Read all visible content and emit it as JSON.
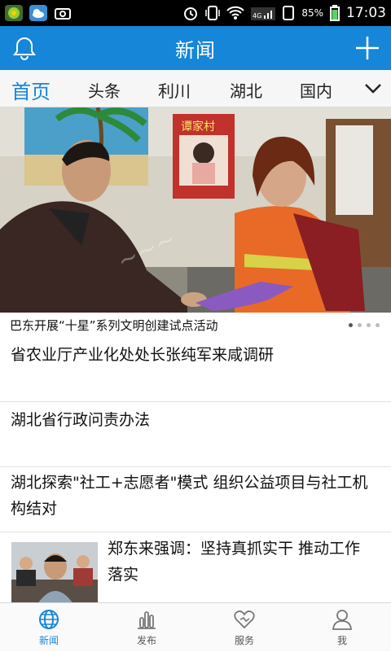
{
  "status_bar": {
    "time": "17:03",
    "battery": "85%",
    "network": "4G",
    "icons": [
      "app-icon-green",
      "weather-icon",
      "screenshot-icon",
      "alarm-icon",
      "vibrate-icon",
      "wifi-icon",
      "signal-icon",
      "battery-icon"
    ]
  },
  "header": {
    "title": "新闻",
    "left_icon": "bell-icon",
    "right_icon": "plus-icon"
  },
  "tabs": [
    {
      "label": "首页",
      "active": true
    },
    {
      "label": "头条",
      "active": false
    },
    {
      "label": "利川",
      "active": false
    },
    {
      "label": "湖北",
      "active": false
    },
    {
      "label": "国内",
      "active": false
    }
  ],
  "hero": {
    "caption": "巴东开展“十星”系列文明创建试点活动",
    "poster_text": "谭家村",
    "slides": 4,
    "current_slide": 1
  },
  "news": [
    {
      "title": "省农业厅产业化处处长张纯军来咸调研"
    },
    {
      "title": "湖北省行政问责办法"
    },
    {
      "title": "湖北探索\"社工+志愿者\"模式 组织公益项目与社工机构结对"
    },
    {
      "title": "郑东来强调：坚持真抓实干 推动工作落实"
    }
  ],
  "bottom_nav": [
    {
      "label": "新闻",
      "icon": "globe-icon",
      "active": true
    },
    {
      "label": "发布",
      "icon": "bar-chart-icon",
      "active": false
    },
    {
      "label": "服务",
      "icon": "heart-icon",
      "active": false
    },
    {
      "label": "我",
      "icon": "person-icon",
      "active": false
    }
  ],
  "colors": {
    "accent": "#1686d9",
    "statusbar": "#000000"
  }
}
